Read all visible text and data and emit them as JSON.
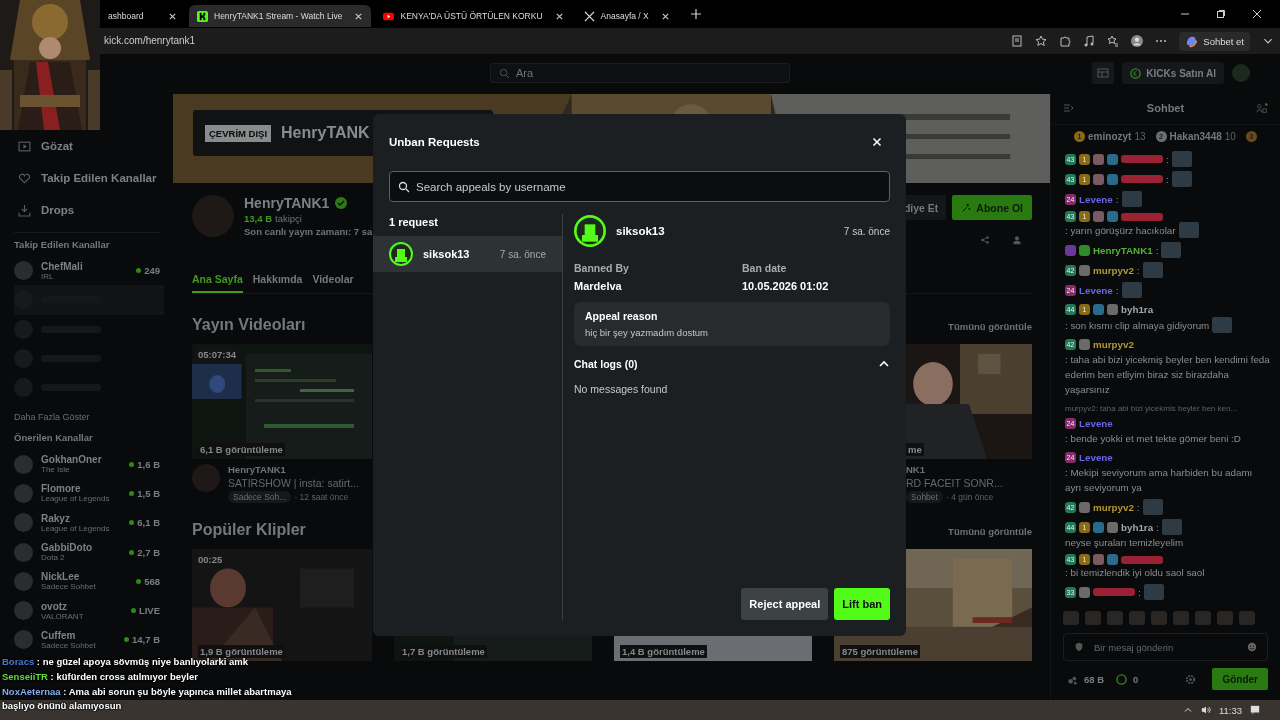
{
  "browser": {
    "tabs": [
      {
        "title": "ashboard",
        "selected": false
      },
      {
        "title": "HenryTANK1 Stream - Watch Live",
        "selected": true
      },
      {
        "title": "KENYA'DA ÜSTÜ ÖRTÜLEN KORKU",
        "selected": false
      },
      {
        "title": "Anasayfa / X",
        "selected": false
      }
    ],
    "url": "kick.com/henrytank1",
    "copilot_label": "Sohbet et"
  },
  "topnav": {
    "search_placeholder": "Ara",
    "buy_label": "KICKs Satın Al"
  },
  "sidebar": {
    "nav": [
      {
        "label": "Gözat"
      },
      {
        "label": "Takip Edilen Kanallar"
      },
      {
        "label": "Drops"
      }
    ],
    "followed_title": "Takip Edilen Kanallar",
    "followed": [
      {
        "kind": "channel",
        "name": "ChefMali",
        "category": "IRL",
        "viewers": "249",
        "selected": false
      },
      {
        "kind": "blurred",
        "selected": true
      },
      {
        "kind": "blurred",
        "selected": false
      },
      {
        "kind": "blurred",
        "selected": false
      },
      {
        "kind": "blurred",
        "selected": false
      }
    ],
    "more_label": "Daha Fazla Göster",
    "recommended_title": "Önerilen Kanallar",
    "recommended": [
      {
        "name": "GokhanOner",
        "category": "The Isle",
        "viewers": "1,6 B",
        "selected": false
      },
      {
        "name": "Flomore",
        "category": "League of Legends",
        "viewers": "1,5 B",
        "selected": false
      },
      {
        "name": "Rakyz",
        "category": "League of Legends",
        "viewers": "6,1 B",
        "selected": false
      },
      {
        "name": "GabbiDoto",
        "category": "Dota 2",
        "viewers": "2,7 B",
        "selected": false
      },
      {
        "name": "NickLee",
        "category": "Sadece Sohbet",
        "viewers": "568",
        "selected": false
      },
      {
        "name": "ovotz",
        "category": "VALORANT",
        "viewers": "LIVE",
        "selected": false
      },
      {
        "name": "Cuffem",
        "category": "Sadece Sohbet",
        "viewers": "14,7 B",
        "selected": false
      }
    ]
  },
  "channel": {
    "offline_badge": "ÇEVRİM DIŞI",
    "banner_name": "HenryTANK",
    "name": "HenryTANK1",
    "verified": true,
    "followers": "13,4 B",
    "followers_label": "takipçi",
    "last_live": "Son canlı yayın zamanı: 7 sa",
    "gift_label": "diye Et",
    "subscribe_label": "Abone Ol",
    "tabs": [
      {
        "label": "Ana Sayfa",
        "selected": true
      },
      {
        "label": "Hakkımda",
        "selected": false
      },
      {
        "label": "Videolar",
        "selected": false
      }
    ]
  },
  "videos": {
    "title": "Yayın Videoları",
    "view_all": "Tümünü görüntüle",
    "cards": [
      {
        "kind": "full",
        "duration": "05:07:34",
        "views": "6,1 B görüntüleme",
        "author": "HenryTANK1",
        "title": "SATIRSHOW | insta: satirt...",
        "tag": "Sadece Soh...",
        "age": "· 12 saat önce"
      },
      {
        "kind": "partial",
        "views": "me",
        "author": "NK1",
        "title": "RD FACEIT SONR...",
        "tag": "Sohbet",
        "age": "· 4 gün önce"
      }
    ]
  },
  "clips": {
    "title": "Popüler Klipler",
    "view_all": "Tümünü görüntüle",
    "cards": [
      {
        "duration": "00:25",
        "views": "1,9 B görüntüleme"
      },
      {
        "views": "1,7 B görüntüleme"
      },
      {
        "views": "1,4 B görüntüleme"
      },
      {
        "views": "875 görüntüleme"
      }
    ]
  },
  "chat": {
    "title": "Sohbet",
    "leaders": [
      {
        "rank": "1",
        "name": "eminozyt",
        "count": "13"
      },
      {
        "rank": "2",
        "name": "Hakan3448",
        "count": "10"
      },
      {
        "rank": "3"
      }
    ],
    "messages": [
      {
        "badges": [
          {
            "kind": "sub",
            "text": "43"
          },
          {
            "kind": "gold",
            "text": "1"
          },
          {
            "kind": "gift"
          },
          {
            "kind": "mod"
          }
        ],
        "color": "#9b2232",
        "parts": [
          {
            "kind": "text",
            "text": ":"
          },
          {
            "kind": "emote"
          }
        ]
      },
      {
        "badges": [
          {
            "kind": "sub",
            "text": "43"
          },
          {
            "kind": "gold",
            "text": "1"
          },
          {
            "kind": "gift"
          },
          {
            "kind": "mod"
          }
        ],
        "color": "#9b2232",
        "parts": [
          {
            "kind": "text",
            "text": ":"
          },
          {
            "kind": "emote"
          }
        ]
      },
      {
        "badges": [
          {
            "kind": "pink",
            "text": "24"
          }
        ],
        "name": "Levene",
        "color": "#4f4fb0",
        "parts": [
          {
            "kind": "text",
            "text": ":"
          },
          {
            "kind": "emote"
          }
        ]
      },
      {
        "badges": [
          {
            "kind": "sub",
            "text": "43"
          },
          {
            "kind": "gold",
            "text": "1"
          },
          {
            "kind": "gift"
          },
          {
            "kind": "mod"
          }
        ],
        "color": "#9b2232",
        "parts": [
          {
            "kind": "text",
            "text": ": yarın görüşürz hacıkolar"
          },
          {
            "kind": "emote"
          }
        ]
      },
      {
        "badges": [
          {
            "kind": "broadcaster"
          },
          {
            "kind": "verified"
          }
        ],
        "name": "HenryTANK1",
        "color": "#3f8a25",
        "parts": [
          {
            "kind": "text",
            "text": ":"
          },
          {
            "kind": "emote"
          }
        ]
      },
      {
        "badges": [
          {
            "kind": "sub",
            "text": "42"
          },
          {
            "kind": "gun"
          }
        ],
        "name": "murpyv2",
        "color": "#8c7525",
        "parts": [
          {
            "kind": "text",
            "text": ":"
          },
          {
            "kind": "emote"
          }
        ]
      },
      {
        "badges": [
          {
            "kind": "pink",
            "text": "24"
          }
        ],
        "name": "Levene",
        "color": "#4f4fb0",
        "parts": [
          {
            "kind": "text",
            "text": ":"
          },
          {
            "kind": "emote"
          }
        ]
      },
      {
        "badges": [
          {
            "kind": "sub",
            "text": "44"
          },
          {
            "kind": "gold",
            "text": "1"
          },
          {
            "kind": "mod"
          },
          {
            "kind": "gun"
          }
        ],
        "name": "byh1ra",
        "color": "#7d8085",
        "parts": [
          {
            "kind": "text",
            "text": ": son kısmı clip almaya gidiyorum"
          },
          {
            "kind": "emote"
          }
        ]
      },
      {
        "badges": [
          {
            "kind": "sub",
            "text": "42"
          },
          {
            "kind": "gun"
          }
        ],
        "name": "murpyv2",
        "color": "#8c7525",
        "parts": [
          {
            "kind": "text",
            "text": ": taha abi bizi yicekmiş beyler ben kendimi feda ederim ben etliyim biraz siz birazdaha yaşarsınız"
          }
        ]
      },
      {
        "reply": "murpyv2: taha abi bizi yicekmis beyler ben ken...",
        "badges": [
          {
            "kind": "pink",
            "text": "24"
          }
        ],
        "name": "Levene",
        "color": "#4f4fb0",
        "parts": [
          {
            "kind": "text",
            "text": ": bende yokki et met tekte gömer beni :D"
          }
        ]
      },
      {
        "badges": [
          {
            "kind": "pink",
            "text": "24"
          }
        ],
        "name": "Levene",
        "color": "#4f4fb0",
        "parts": [
          {
            "kind": "text",
            "text": ": Mekipi seviyorum ama harbiden bu adamı ayrı seviyorum ya"
          }
        ]
      },
      {
        "badges": [
          {
            "kind": "sub",
            "text": "42"
          },
          {
            "kind": "gun"
          }
        ],
        "name": "murpyv2",
        "color": "#8c7525",
        "parts": [
          {
            "kind": "text",
            "text": ":"
          },
          {
            "kind": "emote"
          }
        ]
      },
      {
        "badges": [
          {
            "kind": "sub",
            "text": "44"
          },
          {
            "kind": "gold",
            "text": "1"
          },
          {
            "kind": "mod"
          },
          {
            "kind": "gun"
          }
        ],
        "name": "byh1ra",
        "color": "#7d8085",
        "parts": [
          {
            "kind": "text",
            "text": ":"
          },
          {
            "kind": "emote"
          },
          {
            "kind": "text",
            "text": "neyse şuraları temizleyelim"
          }
        ]
      },
      {
        "badges": [
          {
            "kind": "sub",
            "text": "43"
          },
          {
            "kind": "gold",
            "text": "1"
          },
          {
            "kind": "gift"
          },
          {
            "kind": "mod"
          }
        ],
        "color": "#9b2232",
        "parts": [
          {
            "kind": "text",
            "text": ": bi temizlendik iyi oldu saol saol"
          }
        ]
      },
      {
        "badges": [
          {
            "kind": "sub",
            "text": "33"
          },
          {
            "kind": "gun"
          }
        ],
        "color": "#9b2232",
        "parts": [
          {
            "kind": "text",
            "text": ":"
          },
          {
            "kind": "emote"
          }
        ]
      }
    ],
    "input_placeholder": "Bir mesaj gönderin",
    "points": "68 B",
    "kicks": "0",
    "send_label": "Gönder"
  },
  "stream_overlay": [
    {
      "name": "Boracs",
      "color": "#4a78d8",
      "text": ": ne güzel apoya sövmüş niye banlıyolarki amk"
    },
    {
      "name": "SenseiiTR",
      "color": "#5fdc3c",
      "text": ": küfürden cross atılmıyor beyler"
    },
    {
      "name": "NoxAeternaa",
      "color": "#86aef0",
      "text": ": Ama abi sorun şu böyle yapınca millet abartmaya başlıyo önünü alamıyosun"
    }
  ],
  "modal": {
    "title": "Unban Requests",
    "search_placeholder": "Search appeals by username",
    "count_label": "1 request",
    "requests": [
      {
        "username": "siksok13",
        "age": "7 sa. önce",
        "selected": true
      }
    ],
    "detail": {
      "username": "siksok13",
      "age": "7 sa. önce",
      "banned_by_label": "Banned By",
      "banned_by": "Mardelva",
      "ban_date_label": "Ban date",
      "ban_date": "10.05.2026 01:02",
      "reason_label": "Appeal reason",
      "reason": "hiç bir şey yazmadım dostum",
      "chat_logs_label": "Chat logs (0)",
      "chat_logs_expanded": true,
      "chat_logs_empty": "No messages found"
    },
    "actions": [
      {
        "label": "Reject appeal",
        "kind": "secondary"
      },
      {
        "label": "Lift ban",
        "kind": "primary"
      }
    ]
  },
  "taskbar": {
    "time": "11:33"
  }
}
